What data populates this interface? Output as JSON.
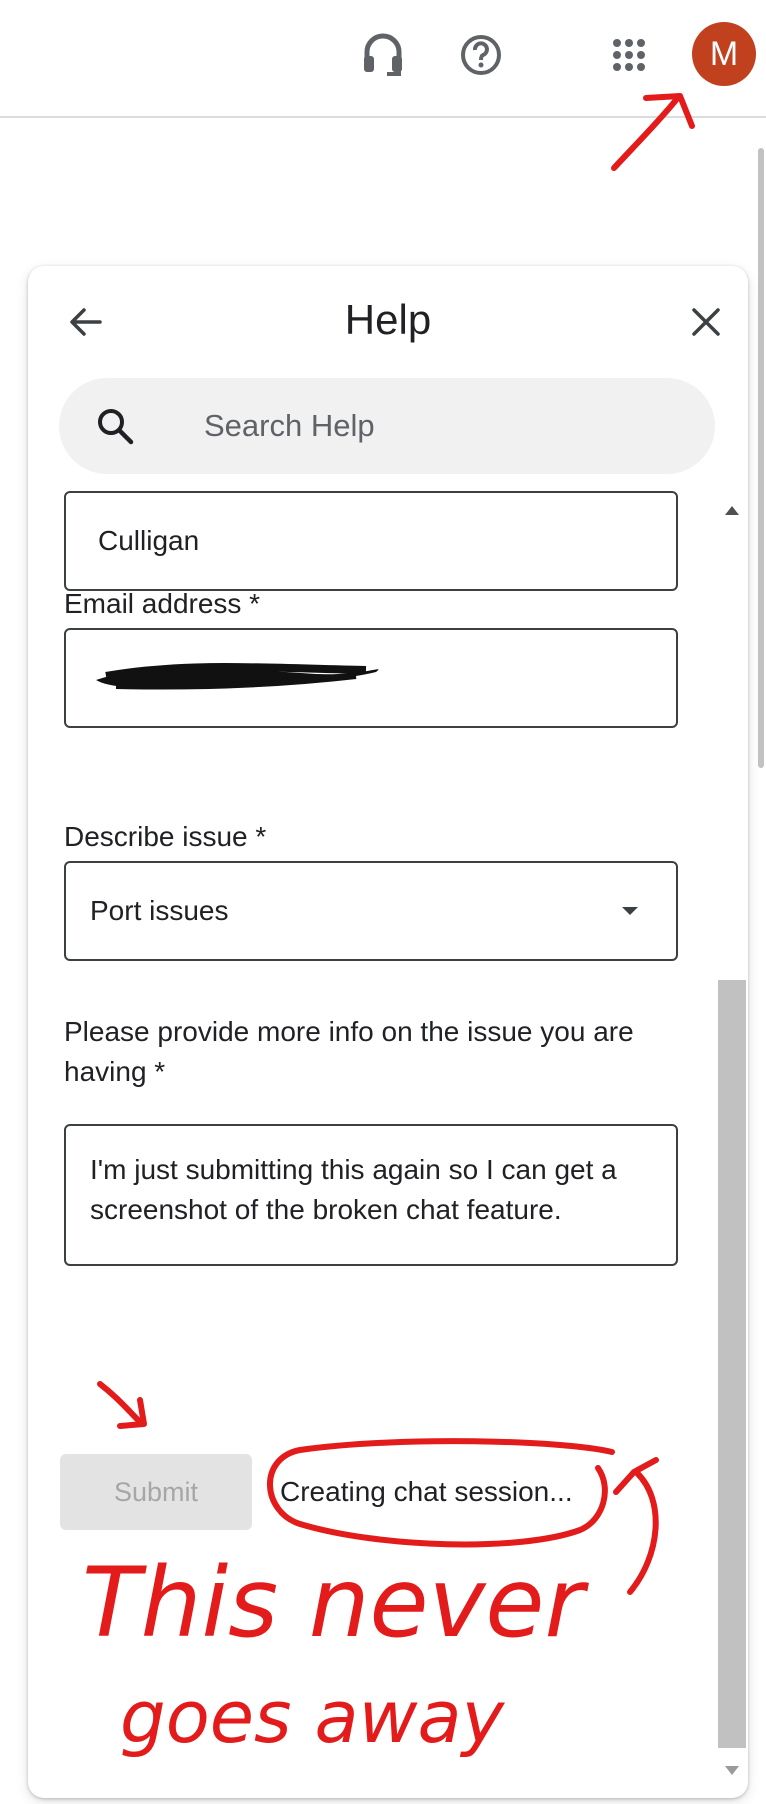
{
  "topbar": {
    "icons": [
      "headset-icon",
      "help-circle-icon",
      "apps-grid-icon"
    ],
    "avatar_initial": "M",
    "avatar_color": "#c1401e"
  },
  "help_panel": {
    "title": "Help",
    "search": {
      "placeholder": "Search Help",
      "value": ""
    },
    "form": {
      "company_value": "Culligan",
      "email_label": "Email address *",
      "email_value": "",
      "issue_label": "Describe issue *",
      "issue_selected": "Port issues",
      "info_label": "Please provide more info on the issue you are having *",
      "info_value": "I'm just submitting this again so I can get a screenshot of the broken chat feature.",
      "submit_label": "Submit",
      "status_text": "Creating chat session..."
    }
  },
  "annotations": {
    "note_line1": "This never",
    "note_line2": "goes away",
    "color": "#e31b1b"
  }
}
